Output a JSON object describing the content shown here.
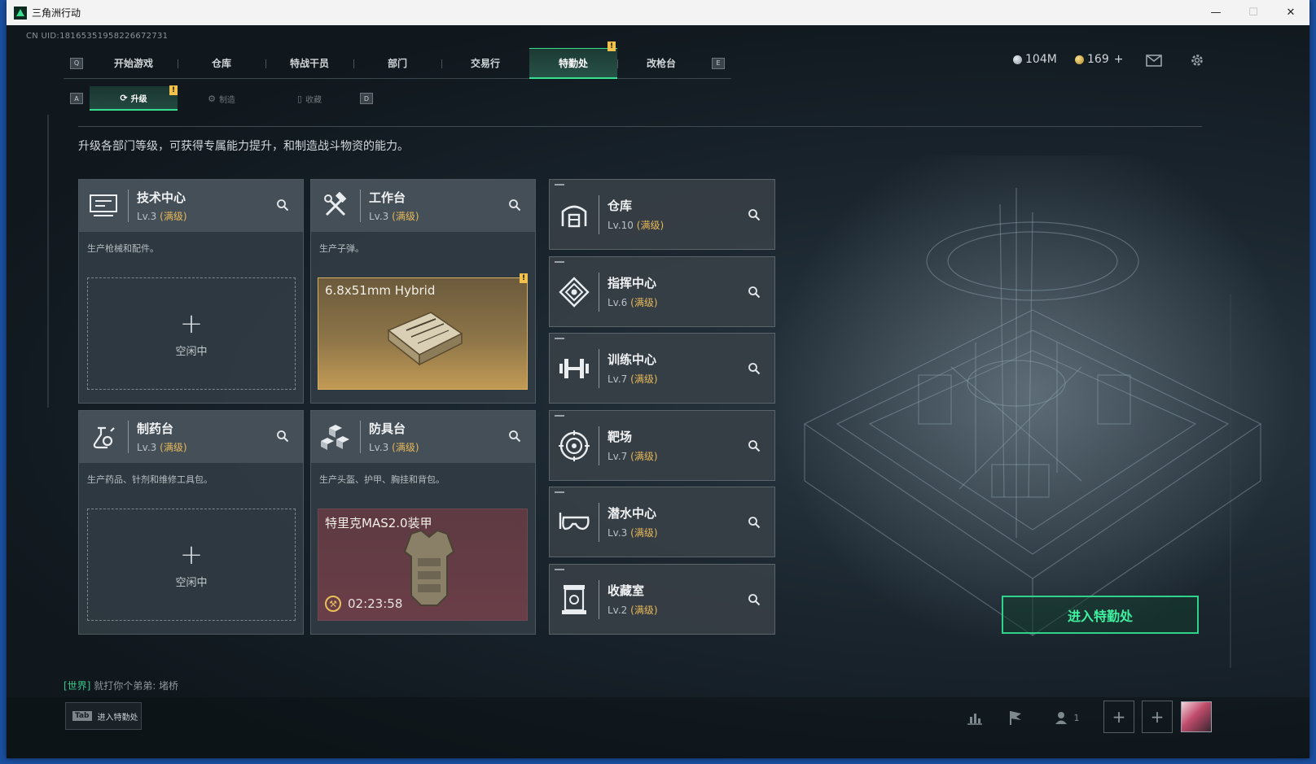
{
  "window": {
    "title": "三角洲行动",
    "controls": [
      "—",
      "☐",
      "✕"
    ]
  },
  "uid": "CN UID:18165351958226672731",
  "topnav": {
    "left_key": "Q",
    "right_key": "E",
    "tabs": [
      "开始游戏",
      "仓库",
      "特战干员",
      "部门",
      "交易行",
      "特勤处",
      "改枪台"
    ],
    "active_index": 5,
    "warn_badge": "!"
  },
  "currency": {
    "silver": "104M",
    "gold": "169",
    "gold_plus": "+"
  },
  "icons": {
    "mail": "mail-icon",
    "settings": "gear-icon"
  },
  "subnav": {
    "left_key": "A",
    "right_key": "D",
    "tabs": [
      {
        "label": "升级",
        "icon": "⟳"
      },
      {
        "label": "制造",
        "icon": "⚙"
      },
      {
        "label": "收藏",
        "icon": "▯"
      }
    ],
    "active_index": 0
  },
  "description": "升级各部门等级，可获得专属能力提升，和制造战斗物资的能力。",
  "production": [
    {
      "name": "技术中心",
      "level": "Lv.3",
      "max": "(满级)",
      "icon": "monitor-icon",
      "desc": "生产枪械和配件。",
      "slot": {
        "state": "empty",
        "label": "空闲中",
        "plus": "+"
      }
    },
    {
      "name": "工作台",
      "level": "Lv.3",
      "max": "(满级)",
      "icon": "hammer-wrench-icon",
      "desc": "生产子弹。",
      "slot": {
        "state": "done",
        "item": "6.8x51mm Hybrid",
        "badge": "!"
      }
    },
    {
      "name": "制药台",
      "level": "Lv.3",
      "max": "(满级)",
      "icon": "flask-icon",
      "desc": "生产药品、针剂和维修工具包。",
      "slot": {
        "state": "empty",
        "label": "空闲中",
        "plus": "+"
      }
    },
    {
      "name": "防具台",
      "level": "Lv.3",
      "max": "(满级)",
      "icon": "armor-blocks-icon",
      "desc": "生产头盔、护甲、胸挂和背包。",
      "slot": {
        "state": "crafting",
        "item": "特里克MAS2.0装甲",
        "timer": "02:23:58"
      }
    }
  ],
  "facilities": [
    {
      "name": "仓库",
      "level": "Lv.10",
      "max": "(满级)",
      "icon": "warehouse-icon"
    },
    {
      "name": "指挥中心",
      "level": "Lv.6",
      "max": "(满级)",
      "icon": "command-icon"
    },
    {
      "name": "训练中心",
      "level": "Lv.7",
      "max": "(满级)",
      "icon": "dumbbell-icon"
    },
    {
      "name": "靶场",
      "level": "Lv.7",
      "max": "(满级)",
      "icon": "target-icon"
    },
    {
      "name": "潜水中心",
      "level": "Lv.3",
      "max": "(满级)",
      "icon": "diving-mask-icon"
    },
    {
      "name": "收藏室",
      "level": "Lv.2",
      "max": "(满级)",
      "icon": "display-case-icon"
    }
  ],
  "enter_button": "进入特勤处",
  "chat": {
    "channel": "[世界]",
    "message": "就打你个弟弟: 堵桥"
  },
  "tab_hint": {
    "key": "Tab",
    "label": "进入特勤处"
  },
  "bottom": {
    "friends_count": "1",
    "plus": "+"
  }
}
